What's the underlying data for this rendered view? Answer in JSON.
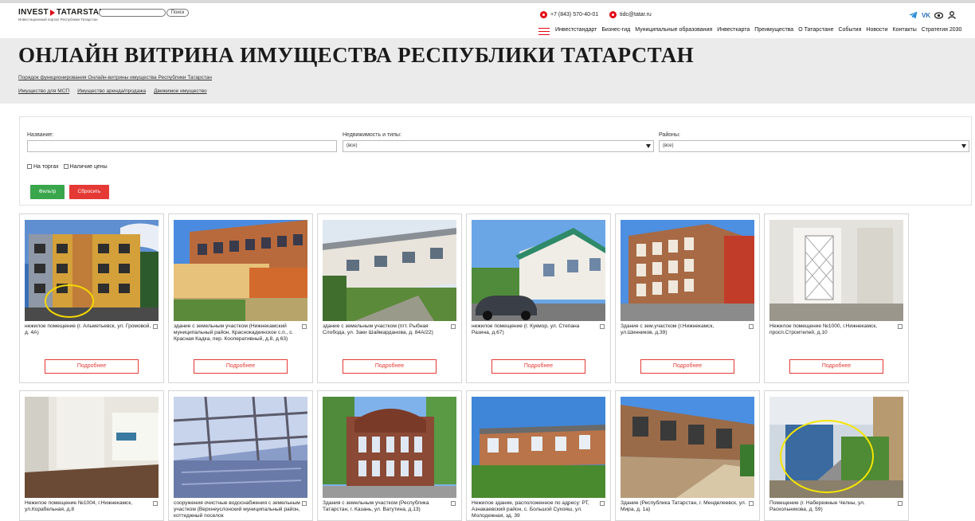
{
  "header": {
    "logo_text_left": "INVEST",
    "logo_text_right": "TATARSTAN",
    "logo_tagline": "Инвестиционный портал Республики Татарстан",
    "search_placeholder": "",
    "search_button": "Поиск",
    "phone": "+7 (843) 570-40-01",
    "email": "tidc@tatar.ru",
    "nav": [
      "Инвестстандарт",
      "Бизнес-гид",
      "Муниципальные образования",
      "Инвесткарта",
      "Преимущества",
      "О Татарстане",
      "События",
      "Новости",
      "Контакты",
      "Стратегия 2030"
    ],
    "icons": {
      "telegram": "telegram-icon",
      "vk": "vk-icon",
      "accessibility": "eye-icon",
      "account": "user-icon"
    }
  },
  "hero": {
    "title": "ОНЛАЙН ВИТРИНА ИМУЩЕСТВА РЕСПУБЛИКИ ТАТАРСТАН",
    "order_link": "Порядок функционирования Онлайн-витрины имущества Республики Татарстан",
    "sublinks": [
      "Имущество для МСП",
      "Имущество аренда/продажа",
      "Движимое имущество"
    ]
  },
  "filter": {
    "name_label": "Название:",
    "name_value": "",
    "type_label": "Недвижимость и типы:",
    "type_value": "(все)",
    "district_label": "Районы:",
    "district_value": "(все)",
    "check_torgi": "На торгах",
    "check_price": "Наличие цены",
    "filter_button": "Фильтр",
    "reset_button": "Сбросить"
  },
  "more_label": "Подробнее",
  "cards": [
    {
      "caption": "нежилое помещение (г. Альметьевск, ул. Громовой, д. 4А)",
      "scene": "apartment"
    },
    {
      "caption": "здание с земельным участком (Нижнекамский муниципальный район, Краснокадкинское с.п., с. Красная Кадка, пер. Кооперативный, д.8, д.63)",
      "scene": "brick-school"
    },
    {
      "caption": "здание с земельным участком (пгт. Рыбная Слобода, ул. Заки Шаймарданова, д. 84А/22)",
      "scene": "white-barn"
    },
    {
      "caption": "нежилое помещение (г. Кукмор, ул. Степана Разина, д.67)",
      "scene": "house-car"
    },
    {
      "caption": "Здание с зем.участком (г.Нижнекамск, ул.Шинников, д.39)",
      "scene": "brick-office"
    },
    {
      "caption": "Нежилое помещение №1000, г.Нижнекамск, просп.Строителей, д.10",
      "scene": "door"
    },
    {
      "caption": "Нежилое помещение №1004, г.Нижнекамск, ул.Корабельная, д.8",
      "scene": "empty-room"
    },
    {
      "caption": "сооружения очистные водоснабжения с земельным участком (Верхнеуслонский муниципальный район, коттеджный поселок",
      "scene": "water-plant"
    },
    {
      "caption": "Здания с земельным участком (Республика Татарстан, г. Казань, ул. Ватутина, д.13)",
      "scene": "historic"
    },
    {
      "caption": "Нежилое здание, расположенное по адресу: РТ, Азнакаевский район, с. Большой Сухояш, ул. Молодежная, зд. 39",
      "scene": "low-brick"
    },
    {
      "caption": "Здание (Республика Татарстан, г. Менделеевск, ул. Мира, д. 1а)",
      "scene": "warehouse"
    },
    {
      "caption": "Помещение (г. Набережные Челны, ул. Раскольникова, д. 59)",
      "scene": "entrance"
    }
  ]
}
